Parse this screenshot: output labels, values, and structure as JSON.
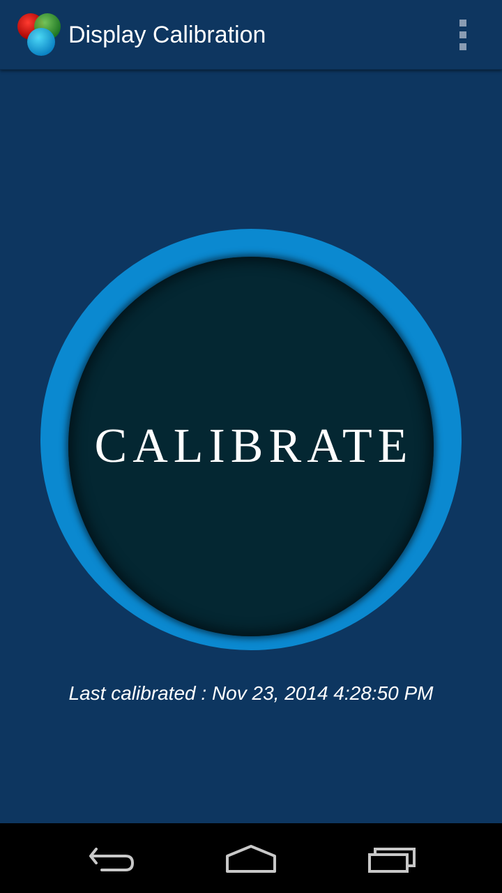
{
  "app": {
    "title": "Display Calibration",
    "icon": "rgb-circles-icon"
  },
  "action_bar": {
    "overflow_icon": "overflow-menu-icon"
  },
  "main": {
    "calibrate_label": "CALIBRATE",
    "last_calibrated": "Last calibrated : Nov 23, 2014 4:28:50 PM"
  },
  "nav_bar": {
    "back_icon": "back-icon",
    "home_icon": "home-icon",
    "recents_icon": "recents-icon"
  },
  "colors": {
    "background": "#0d3660",
    "button_fill": "#042732",
    "glow": "#0b89d0",
    "text": "#ffffff",
    "nav_bar": "#000000",
    "nav_icon": "#c8c8c8"
  }
}
